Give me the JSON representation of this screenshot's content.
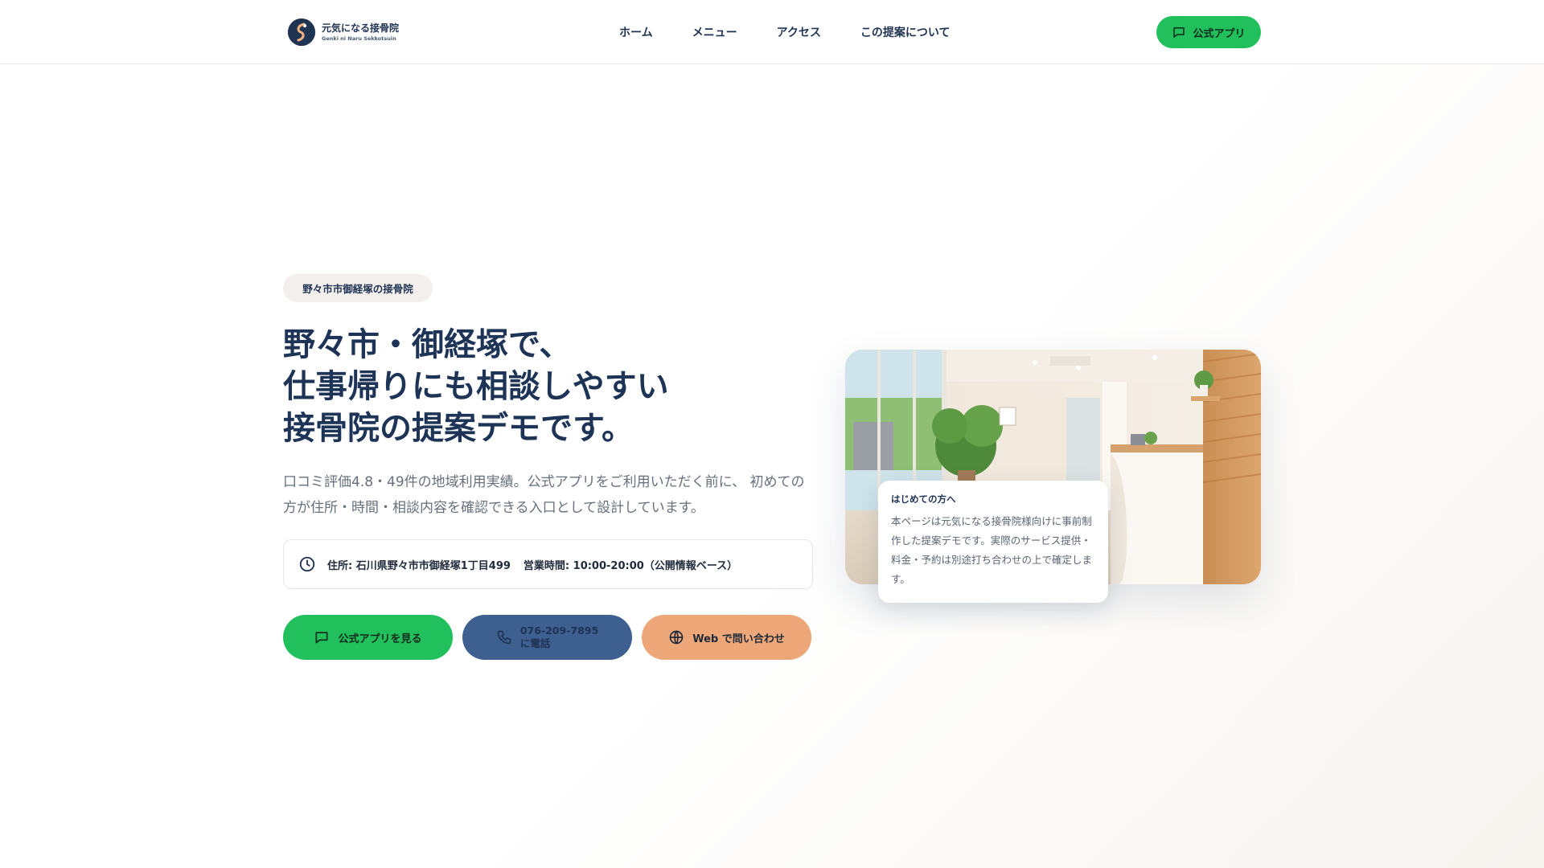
{
  "header": {
    "logo_name": "元気になる接骨院",
    "logo_sub": "Genki ni Naru Sekkotsuin",
    "nav": [
      {
        "label": "ホーム"
      },
      {
        "label": "メニュー"
      },
      {
        "label": "アクセス"
      },
      {
        "label": "この提案について"
      }
    ],
    "app_button": "公式アプリ"
  },
  "hero": {
    "tag": "野々市市御経塚の接骨院",
    "title_lines": [
      "野々市・御経塚で、",
      "仕事帰りにも相談しやすい",
      "接骨院の提案デモです。"
    ],
    "description": "口コミ評価4.8・49件の地域利用実績。公式アプリをご利用いただく前に、 初めての方が住所・時間・相談内容を確認できる入口として設計しています。",
    "info": {
      "address": "住所: 石川県野々市市御経塚1丁目499",
      "hours": "営業時間: 10:00-20:00（公開情報ベース）"
    },
    "cta": {
      "app": "公式アプリを見る",
      "phone_number": "076-209-7895",
      "phone_suffix": "に電話",
      "web": "Web で問い合わせ"
    }
  },
  "note": {
    "title": "はじめての方へ",
    "body": "本ページは元気になる接骨院様向けに事前制作した提案デモです。実際のサービス提供・料金・予約は別途打ち合わせの上で確定します。"
  },
  "colors": {
    "navy": "#1f3352",
    "green": "#22c05d",
    "blue": "#3d6091",
    "peach": "#eda779"
  },
  "icons": {
    "header_button": "chat-bubble-icon",
    "info": "clock-icon",
    "cta_app": "chat-bubble-icon",
    "cta_phone": "phone-icon",
    "cta_web": "globe-icon"
  }
}
